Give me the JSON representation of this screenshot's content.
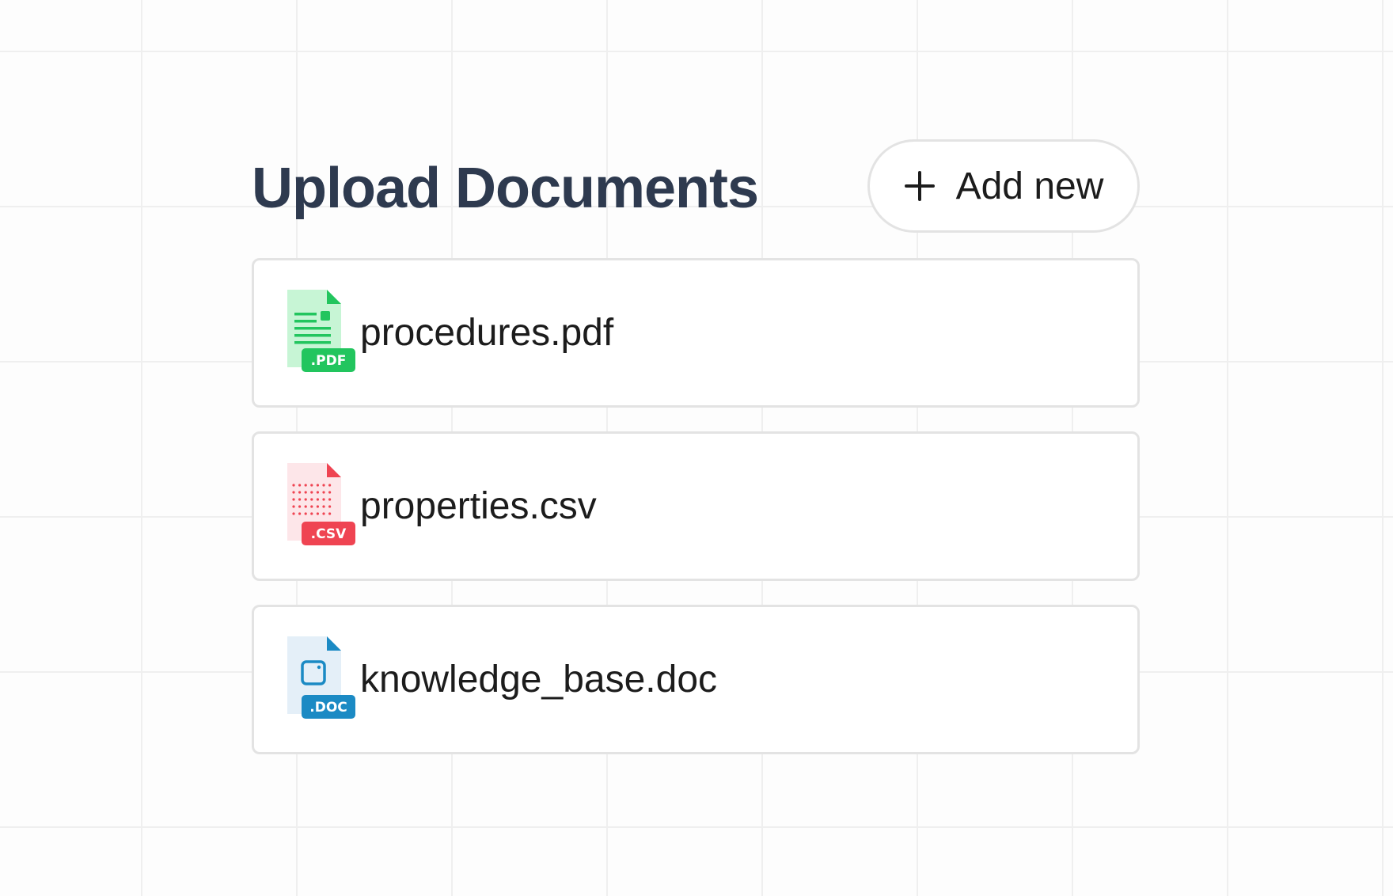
{
  "header": {
    "title": "Upload Documents",
    "add_button_label": "Add new",
    "add_button_icon": "plus-icon"
  },
  "files": [
    {
      "name": "procedures.pdf",
      "badge": ".PDF",
      "icon": "pdf-file-icon",
      "accent_color": "#22c55e",
      "light_color": "#c7f5d5"
    },
    {
      "name": "properties.csv",
      "badge": ".CSV",
      "icon": "csv-file-icon",
      "accent_color": "#ef4452",
      "light_color": "#fde6e9"
    },
    {
      "name": "knowledge_base.doc",
      "badge": ".DOC",
      "icon": "doc-file-icon",
      "accent_color": "#1b8ac4",
      "light_color": "#e4eff8"
    }
  ]
}
